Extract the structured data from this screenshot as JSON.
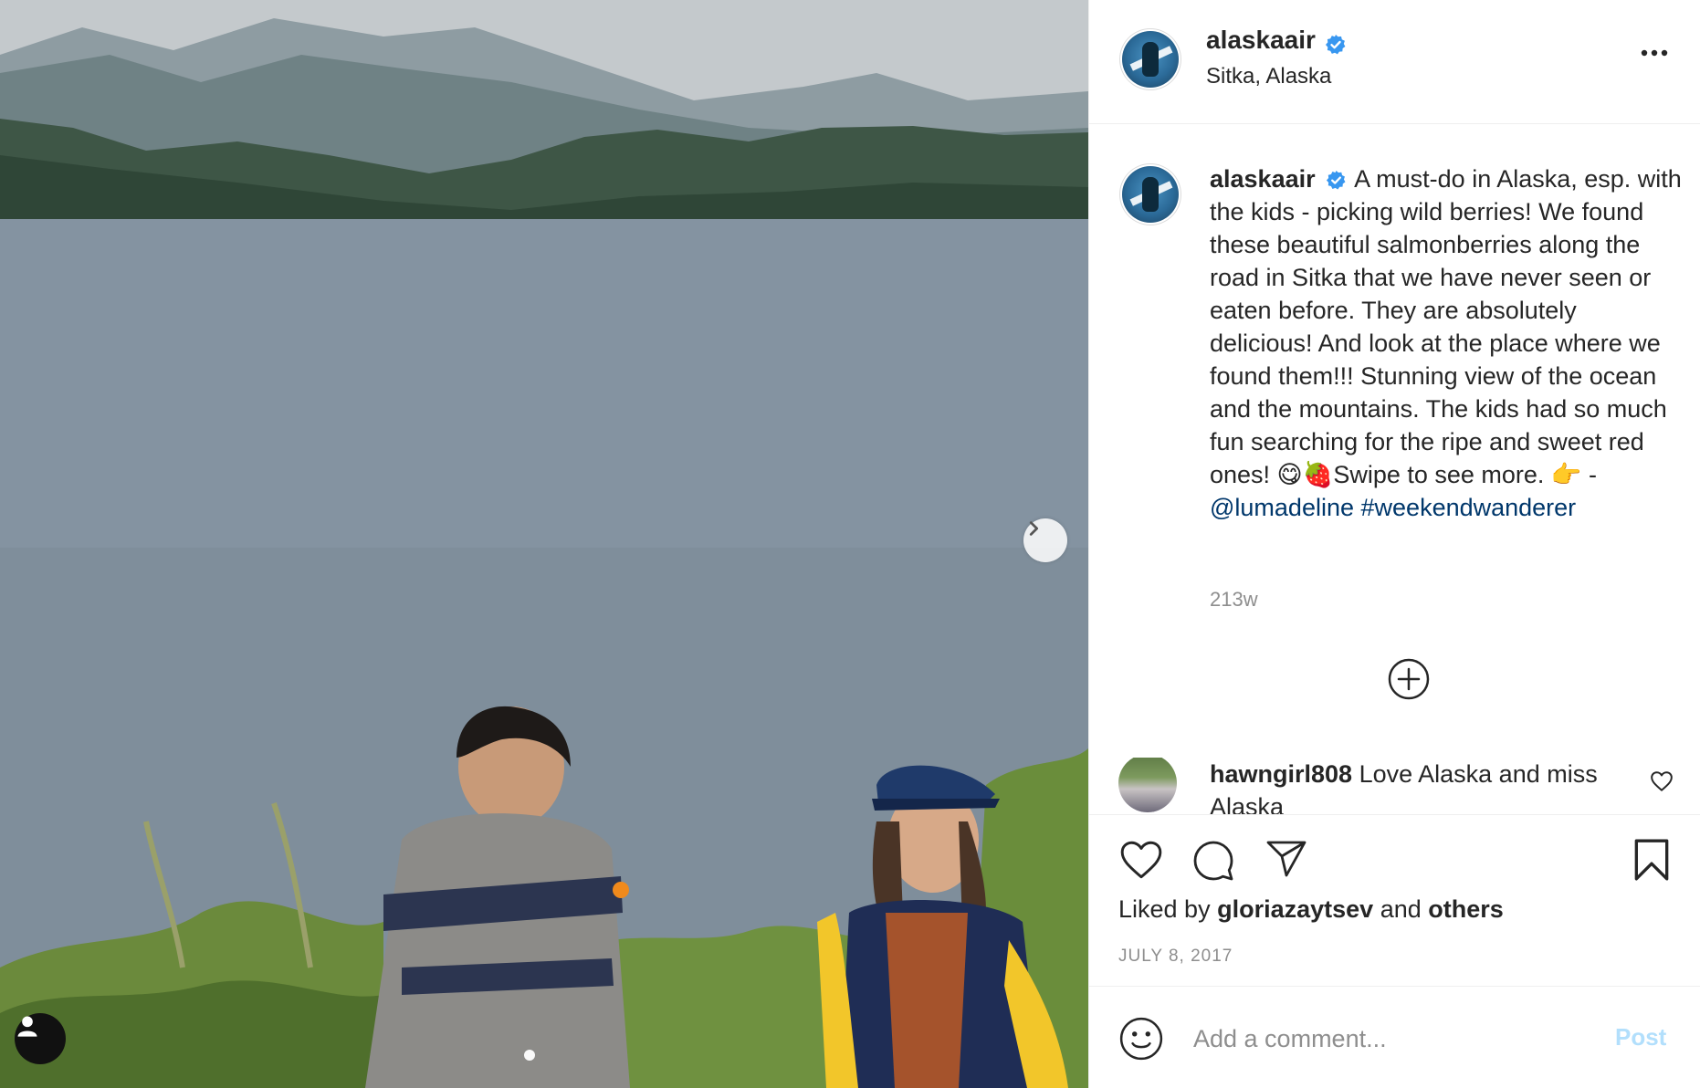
{
  "header": {
    "username": "alaskaair",
    "location": "Sitka, Alaska"
  },
  "caption": {
    "username": "alaskaair",
    "text": "A must-do in Alaska, esp. with the kids - picking wild berries! We found these beautiful salmonberries along the road in Sitka that we have never seen or eaten before. They are absolutely delicious! And look at the place where we found them!!! Stunning view of the ocean and the mountains. The kids had so much fun searching for the ripe and sweet red ones! 😋🍓Swipe to see more. 👉 - ",
    "mention": "@lumadeline",
    "hashtag": "#weekendwanderer",
    "time": "213w"
  },
  "comment": {
    "username": "hawngirl808",
    "text": "Love Alaska and miss Alaska"
  },
  "likes": {
    "prefix": "Liked by",
    "user": "gloriazaytsev",
    "conjunction": "and",
    "others": "others"
  },
  "post_date": "JULY 8, 2017",
  "comment_box": {
    "placeholder": "Add a comment...",
    "post_label": "Post"
  },
  "icons": {
    "verified": "verified-badge-icon",
    "more": "more-options-icon",
    "load_more": "plus-circle-icon",
    "like": "heart-icon",
    "comment": "comment-bubble-icon",
    "share": "paper-plane-icon",
    "save": "bookmark-icon",
    "emoji": "smiley-icon",
    "next": "chevron-right-icon",
    "tags": "user-tag-icon"
  },
  "colors": {
    "link": "#00376b",
    "verified": "#3897f0",
    "post_button": "#b2dffc",
    "muted": "#8e8e8e"
  }
}
